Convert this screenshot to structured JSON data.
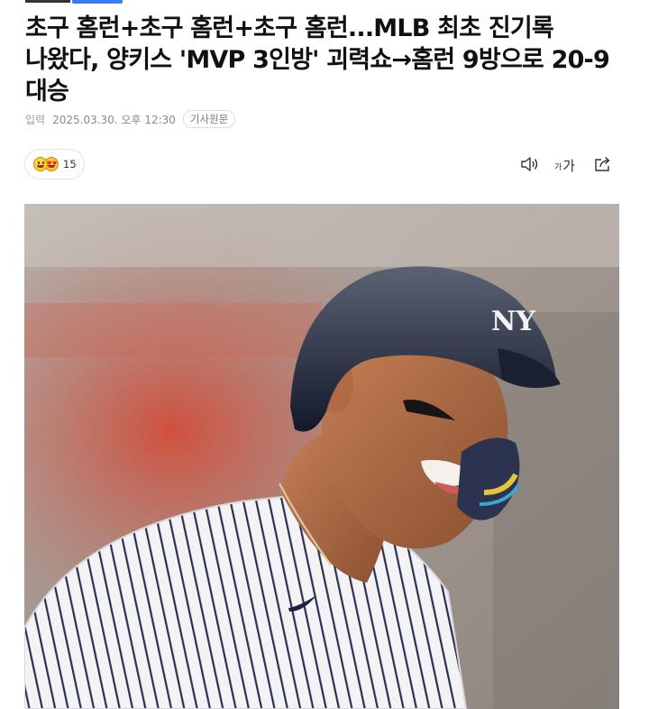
{
  "article": {
    "title": "초구 홈런+초구 홈런+초구 홈런...MLB 최초 진기록 나왔다, 양키스 'MVP 3인방' 괴력쇼→홈런 9방으로 20-9 대승",
    "meta": {
      "input_label": "입력",
      "datetime": "2025.03.30. 오후 12:30",
      "original_button": "기사원문"
    }
  },
  "reactions": {
    "count": "15",
    "emojis": [
      "smile-emoji",
      "heart-eyes-emoji"
    ]
  },
  "toolbar": {
    "font_small": "가",
    "font_big": "가"
  },
  "photo": {
    "description_icon": "photo",
    "helmet_logo": "NY"
  },
  "colors": {
    "accent_blue": "#3d7cf0",
    "text": "#111111",
    "meta_gray": "#888888"
  }
}
